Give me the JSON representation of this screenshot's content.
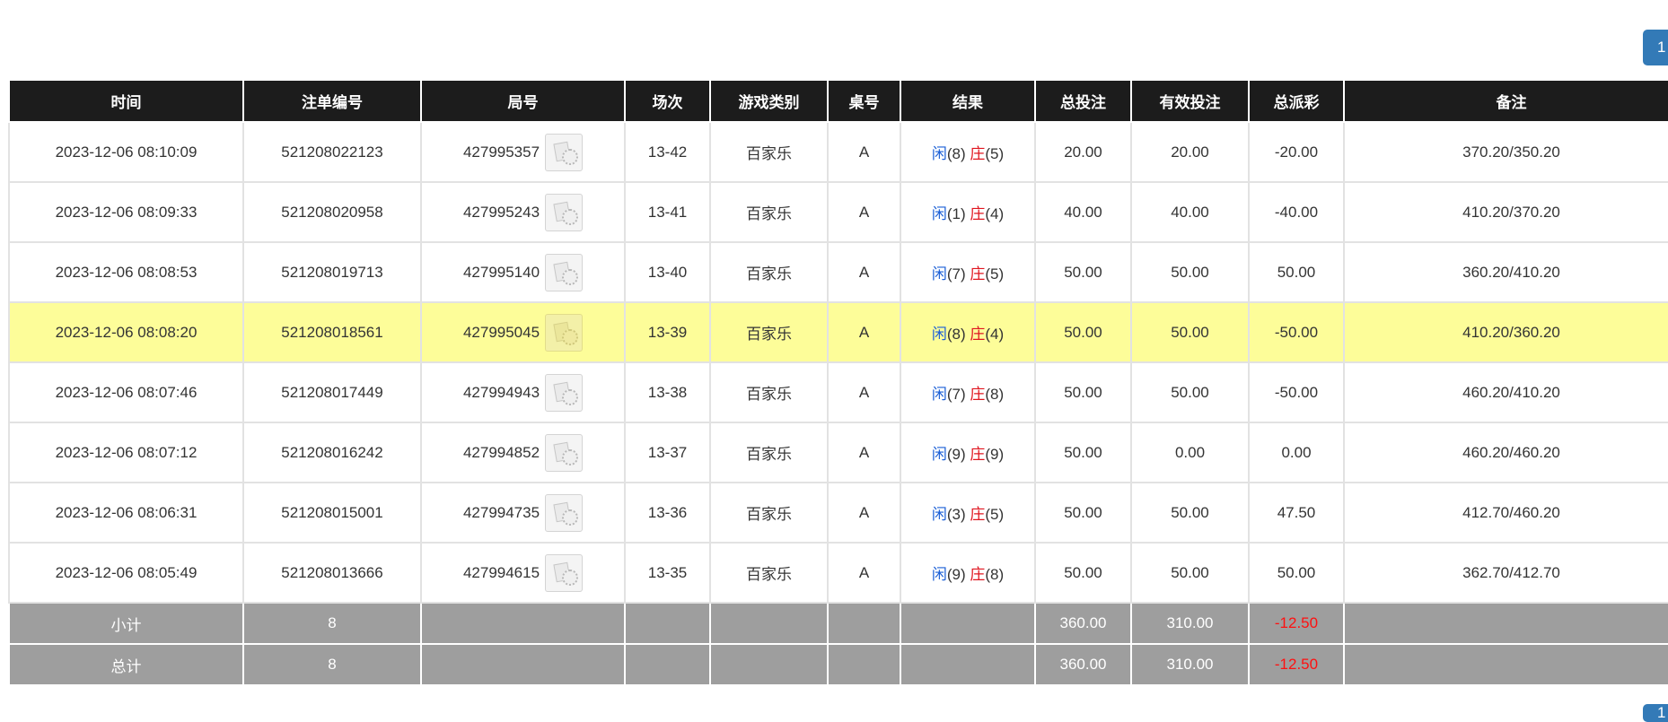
{
  "pagination": {
    "top_page": "1",
    "bottom_page": "1"
  },
  "table": {
    "headers": [
      "时间",
      "注单编号",
      "局号",
      "场次",
      "游戏类别",
      "桌号",
      "结果",
      "总投注",
      "有效投注",
      "总派彩",
      "备注"
    ],
    "rows": [
      {
        "time": "2023-12-06 08:10:09",
        "bet_id": "521208022123",
        "round": "427995357",
        "session": "13-42",
        "game": "百家乐",
        "table_no": "A",
        "player_label": "闲",
        "player_score": "(8)",
        "banker_label": "庄",
        "banker_score": "(5)",
        "total_bet": "20.00",
        "valid_bet": "20.00",
        "payout": "-20.00",
        "payout_negative": true,
        "note": "370.20/350.20",
        "highlight": false
      },
      {
        "time": "2023-12-06 08:09:33",
        "bet_id": "521208020958",
        "round": "427995243",
        "session": "13-41",
        "game": "百家乐",
        "table_no": "A",
        "player_label": "闲",
        "player_score": "(1)",
        "banker_label": "庄",
        "banker_score": "(4)",
        "total_bet": "40.00",
        "valid_bet": "40.00",
        "payout": "-40.00",
        "payout_negative": true,
        "note": "410.20/370.20",
        "highlight": false
      },
      {
        "time": "2023-12-06 08:08:53",
        "bet_id": "521208019713",
        "round": "427995140",
        "session": "13-40",
        "game": "百家乐",
        "table_no": "A",
        "player_label": "闲",
        "player_score": "(7)",
        "banker_label": "庄",
        "banker_score": "(5)",
        "total_bet": "50.00",
        "valid_bet": "50.00",
        "payout": "50.00",
        "payout_negative": false,
        "note": "360.20/410.20",
        "highlight": false
      },
      {
        "time": "2023-12-06 08:08:20",
        "bet_id": "521208018561",
        "round": "427995045",
        "session": "13-39",
        "game": "百家乐",
        "table_no": "A",
        "player_label": "闲",
        "player_score": "(8)",
        "banker_label": "庄",
        "banker_score": "(4)",
        "total_bet": "50.00",
        "valid_bet": "50.00",
        "payout": "-50.00",
        "payout_negative": true,
        "note": "410.20/360.20",
        "highlight": true
      },
      {
        "time": "2023-12-06 08:07:46",
        "bet_id": "521208017449",
        "round": "427994943",
        "session": "13-38",
        "game": "百家乐",
        "table_no": "A",
        "player_label": "闲",
        "player_score": "(7)",
        "banker_label": "庄",
        "banker_score": "(8)",
        "total_bet": "50.00",
        "valid_bet": "50.00",
        "payout": "-50.00",
        "payout_negative": true,
        "note": "460.20/410.20",
        "highlight": false
      },
      {
        "time": "2023-12-06 08:07:12",
        "bet_id": "521208016242",
        "round": "427994852",
        "session": "13-37",
        "game": "百家乐",
        "table_no": "A",
        "player_label": "闲",
        "player_score": "(9)",
        "banker_label": "庄",
        "banker_score": "(9)",
        "total_bet": "50.00",
        "valid_bet": "0.00",
        "payout": "0.00",
        "payout_negative": false,
        "note": "460.20/460.20",
        "highlight": false
      },
      {
        "time": "2023-12-06 08:06:31",
        "bet_id": "521208015001",
        "round": "427994735",
        "session": "13-36",
        "game": "百家乐",
        "table_no": "A",
        "player_label": "闲",
        "player_score": "(3)",
        "banker_label": "庄",
        "banker_score": "(5)",
        "total_bet": "50.00",
        "valid_bet": "50.00",
        "payout": "47.50",
        "payout_negative": false,
        "note": "412.70/460.20",
        "highlight": false
      },
      {
        "time": "2023-12-06 08:05:49",
        "bet_id": "521208013666",
        "round": "427994615",
        "session": "13-35",
        "game": "百家乐",
        "table_no": "A",
        "player_label": "闲",
        "player_score": "(9)",
        "banker_label": "庄",
        "banker_score": "(8)",
        "total_bet": "50.00",
        "valid_bet": "50.00",
        "payout": "50.00",
        "payout_negative": false,
        "note": "362.70/412.70",
        "highlight": false
      }
    ],
    "subtotal": {
      "label": "小计",
      "count": "8",
      "total_bet": "360.00",
      "valid_bet": "310.00",
      "payout": "-12.50"
    },
    "grand_total": {
      "label": "总计",
      "count": "8",
      "total_bet": "360.00",
      "valid_bet": "310.00",
      "payout": "-12.50"
    }
  },
  "colors": {
    "header_bg": "#1c1c1c",
    "summary_bg": "#9e9e9e",
    "highlight_row": "#fdfd99",
    "player_blue": "#1b5fd6",
    "banker_red": "#e0141e",
    "pagination": "#337ab7"
  }
}
